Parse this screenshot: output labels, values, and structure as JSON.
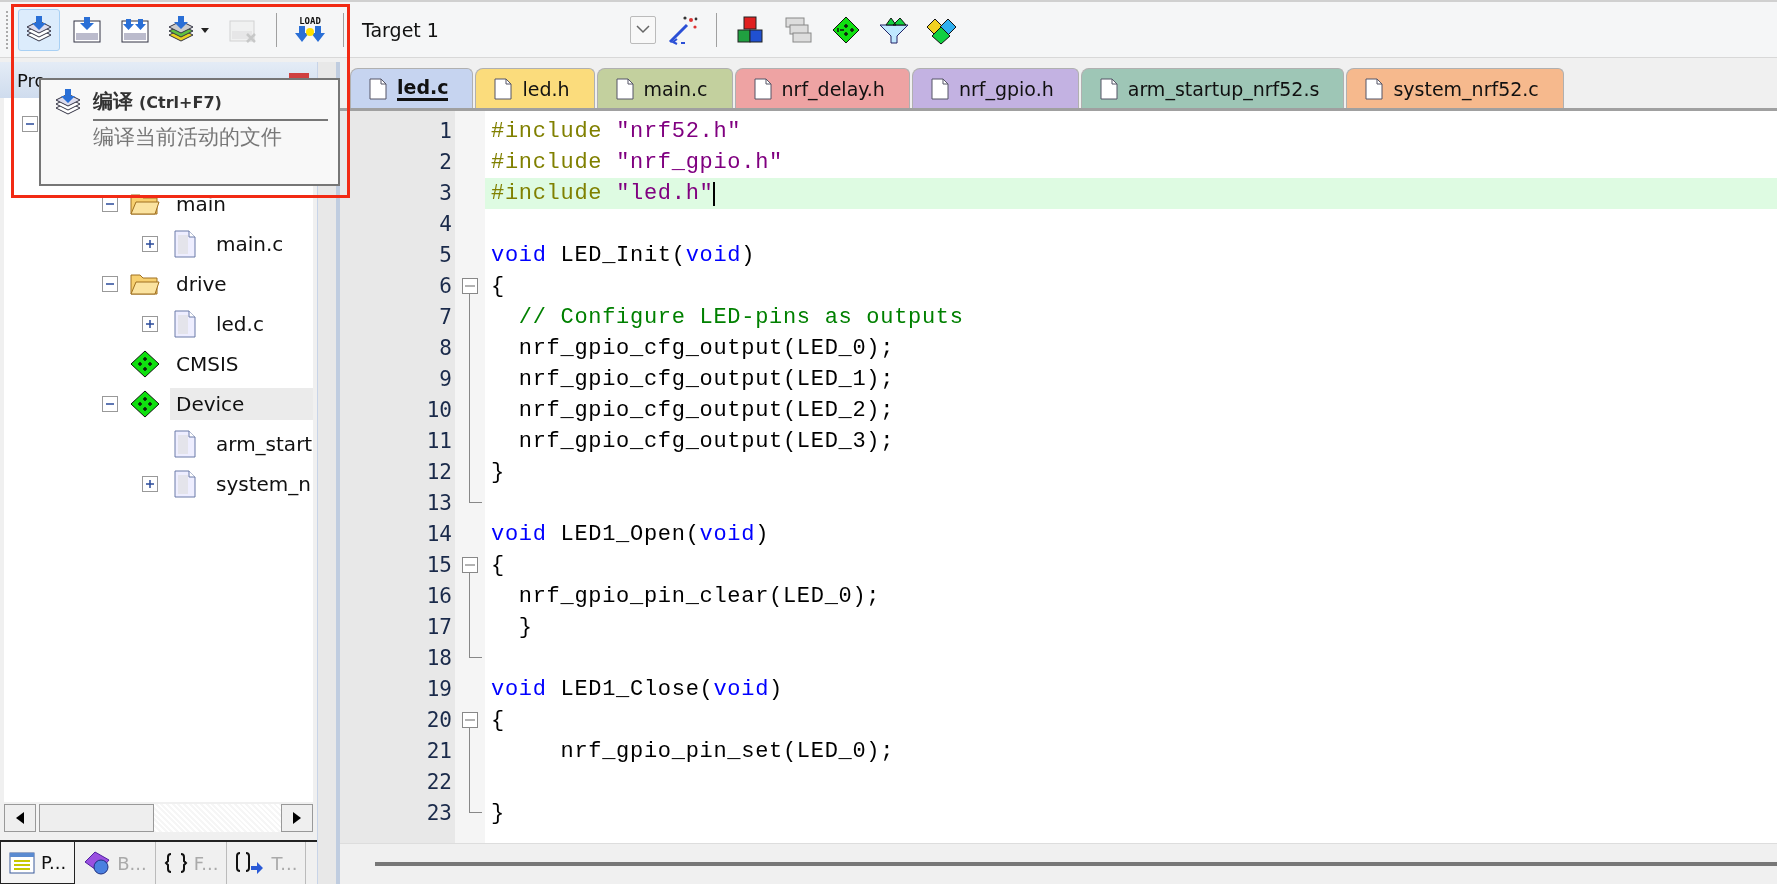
{
  "toolbar": {
    "buttons": [
      {
        "kind": "translate",
        "highlighted": true,
        "disabled": false
      },
      {
        "kind": "build",
        "highlighted": false,
        "disabled": false
      },
      {
        "kind": "rebuild",
        "highlighted": false,
        "disabled": false
      },
      {
        "kind": "batch",
        "highlighted": false,
        "disabled": false
      },
      {
        "kind": "stop",
        "highlighted": false,
        "disabled": true
      }
    ],
    "load": {
      "label": "LOAD"
    },
    "target": {
      "value": "Target 1"
    },
    "tools": [
      {
        "kind": "wand"
      },
      {
        "kind": "blocks"
      },
      {
        "kind": "windows"
      },
      {
        "kind": "diamond"
      },
      {
        "kind": "funnel"
      },
      {
        "kind": "packs"
      }
    ]
  },
  "project_panel": {
    "title": "Pro",
    "tree": [
      {
        "expanded": true,
        "children": [
          {
            "children": [
              {
                "label": "main",
                "kind": "folder",
                "expanded": true,
                "selected": false,
                "children": [
                  {
                    "label": "main.c",
                    "kind": "file",
                    "expanded": false,
                    "selected": false
                  }
                ]
              },
              {
                "label": "drive",
                "kind": "folder",
                "expanded": true,
                "selected": false,
                "children": [
                  {
                    "label": "led.c",
                    "kind": "file",
                    "expanded": false,
                    "selected": false
                  }
                ]
              },
              {
                "label": "CMSIS",
                "kind": "component",
                "selected": false
              },
              {
                "label": "Device",
                "kind": "component",
                "expanded": true,
                "selected": true,
                "children": [
                  {
                    "label": "arm_start",
                    "kind": "file",
                    "selected": false
                  },
                  {
                    "label": "system_n",
                    "kind": "file",
                    "expanded": false,
                    "selected": false
                  }
                ]
              }
            ]
          }
        ]
      }
    ],
    "bottom_tabs": [
      {
        "label": "P...",
        "kind": "project",
        "selected": true
      },
      {
        "label": "B...",
        "kind": "books",
        "selected": false
      },
      {
        "label": "F...",
        "kind": "functions",
        "selected": false
      },
      {
        "label": "T...",
        "kind": "templates",
        "selected": false
      }
    ]
  },
  "tooltip": {
    "title": "编译",
    "shortcut": "(Ctrl+F7)",
    "description": "编译当前活动的文件"
  },
  "editor": {
    "tabs": [
      {
        "label": "led.c",
        "color": "#c6d4f0",
        "selected": true
      },
      {
        "label": "led.h",
        "color": "#fbdc7c",
        "selected": false
      },
      {
        "label": "main.c",
        "color": "#c3d09e",
        "selected": false
      },
      {
        "label": "nrf_delay.h",
        "color": "#eea3a3",
        "selected": false
      },
      {
        "label": "nrf_gpio.h",
        "color": "#c3b2e2",
        "selected": false
      },
      {
        "label": "arm_startup_nrf52.s",
        "color": "#9ec6b6",
        "selected": false
      },
      {
        "label": "system_nrf52.c",
        "color": "#f6b98d",
        "selected": false
      }
    ],
    "lines": [
      {
        "number": "1",
        "tokens": [
          {
            "kind": "pre",
            "text": "#include "
          },
          {
            "kind": "str",
            "text": "\"nrf52.h\""
          }
        ]
      },
      {
        "number": "2",
        "tokens": [
          {
            "kind": "pre",
            "text": "#include "
          },
          {
            "kind": "str",
            "text": "\"nrf_gpio.h\""
          }
        ]
      },
      {
        "number": "3",
        "current": true,
        "tokens": [
          {
            "kind": "pre",
            "text": "#include "
          },
          {
            "kind": "str",
            "text": "\"led.h\""
          }
        ]
      },
      {
        "number": "4"
      },
      {
        "number": "5",
        "tokens": [
          {
            "kind": "kw",
            "text": "void"
          },
          {
            "kind": "plain",
            "text": " LED_Init("
          },
          {
            "kind": "kw",
            "text": "void"
          },
          {
            "kind": "plain",
            "text": ")"
          }
        ]
      },
      {
        "number": "6",
        "fold_start": true,
        "tokens": [
          {
            "kind": "plain",
            "text": "{"
          }
        ]
      },
      {
        "number": "7",
        "tokens": [
          {
            "kind": "cmt",
            "text": "  // Configure LED-pins as outputs"
          }
        ]
      },
      {
        "number": "8",
        "tokens": [
          {
            "kind": "plain",
            "text": "  nrf_gpio_cfg_output(LED_0);"
          }
        ]
      },
      {
        "number": "9",
        "tokens": [
          {
            "kind": "plain",
            "text": "  nrf_gpio_cfg_output(LED_1);"
          }
        ]
      },
      {
        "number": "10",
        "tokens": [
          {
            "kind": "plain",
            "text": "  nrf_gpio_cfg_output(LED_2);"
          }
        ]
      },
      {
        "number": "11",
        "tokens": [
          {
            "kind": "plain",
            "text": "  nrf_gpio_cfg_output(LED_3);"
          }
        ]
      },
      {
        "number": "12",
        "tokens": [
          {
            "kind": "plain",
            "text": "}"
          }
        ]
      },
      {
        "number": "13",
        "fold_end": true
      },
      {
        "number": "14",
        "tokens": [
          {
            "kind": "kw",
            "text": "void"
          },
          {
            "kind": "plain",
            "text": " LED1_Open("
          },
          {
            "kind": "kw",
            "text": "void"
          },
          {
            "kind": "plain",
            "text": ")"
          }
        ]
      },
      {
        "number": "15",
        "fold_start": true,
        "tokens": [
          {
            "kind": "plain",
            "text": "{"
          }
        ]
      },
      {
        "number": "16",
        "tokens": [
          {
            "kind": "plain",
            "text": "  nrf_gpio_pin_clear(LED_0);"
          }
        ]
      },
      {
        "number": "17",
        "tokens": [
          {
            "kind": "plain",
            "text": "  }"
          }
        ]
      },
      {
        "number": "18",
        "fold_end": true
      },
      {
        "number": "19",
        "tokens": [
          {
            "kind": "kw",
            "text": "void"
          },
          {
            "kind": "plain",
            "text": " LED1_Close("
          },
          {
            "kind": "kw",
            "text": "void"
          },
          {
            "kind": "plain",
            "text": ")"
          }
        ]
      },
      {
        "number": "20",
        "fold_start": true,
        "tokens": [
          {
            "kind": "plain",
            "text": "{"
          }
        ]
      },
      {
        "number": "21",
        "tokens": [
          {
            "kind": "plain",
            "text": "     nrf_gpio_pin_set(LED_0);"
          }
        ]
      },
      {
        "number": "22"
      },
      {
        "number": "23",
        "fold_end": true,
        "tokens": [
          {
            "kind": "plain",
            "text": "}"
          }
        ]
      }
    ]
  }
}
